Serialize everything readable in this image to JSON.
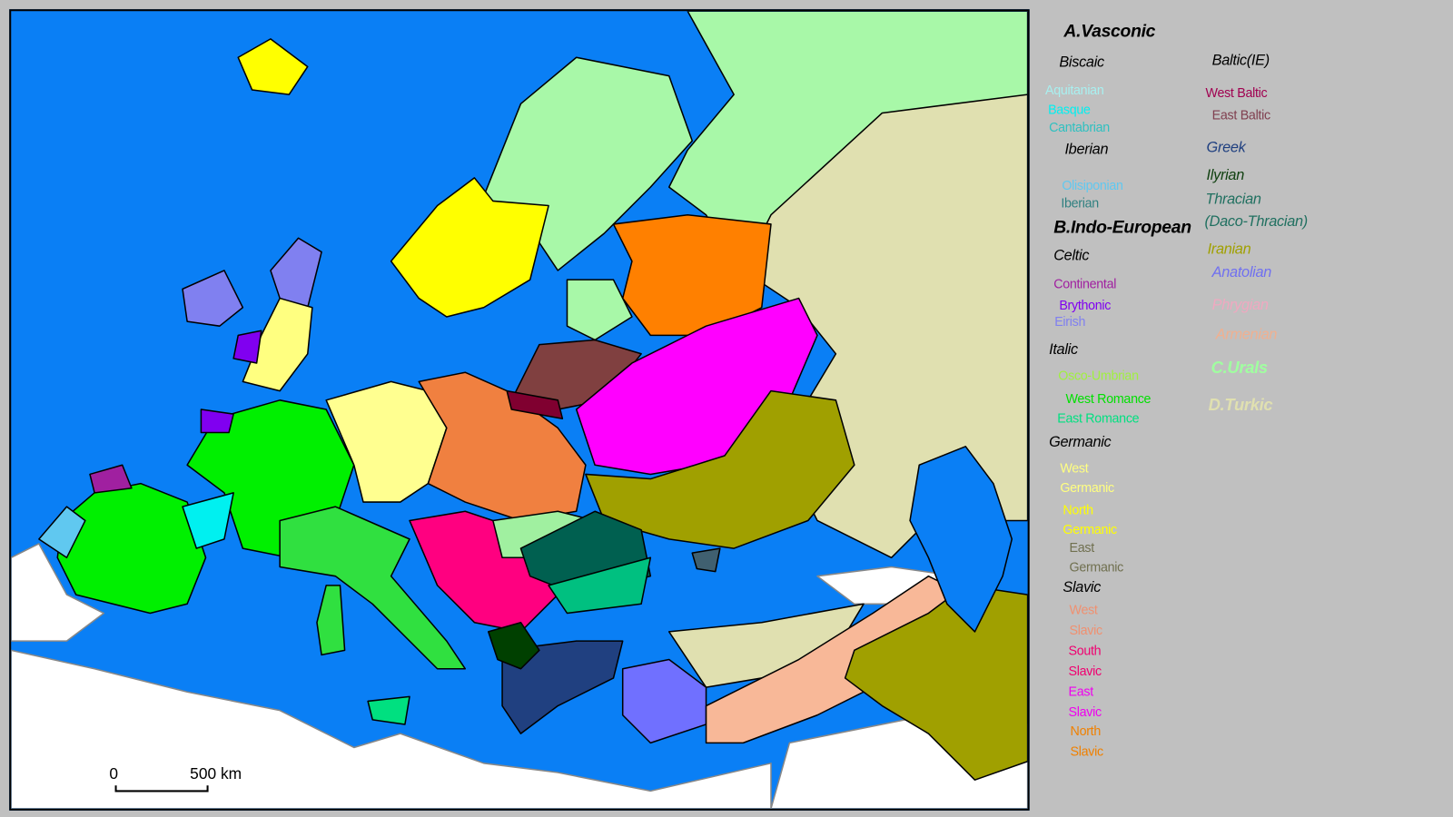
{
  "legend": {
    "a_vasconic": {
      "text": "A.Vasconic",
      "color": "#000000"
    },
    "biscaic": {
      "text": "Biscaic",
      "color": "#000000"
    },
    "aquitanian": {
      "text": "Aquitanian",
      "color": "#a8f0f0"
    },
    "basque": {
      "text": "Basque",
      "color": "#00f0f0"
    },
    "cantabrian": {
      "text": "Cantabrian",
      "color": "#30c0c0"
    },
    "iberian_group": {
      "text": "Iberian",
      "color": "#000000"
    },
    "olisiponian": {
      "text": "Olisiponian",
      "color": "#60c8f0"
    },
    "iberian": {
      "text": "Iberian",
      "color": "#308080"
    },
    "b_indo_european": {
      "text": "B.Indo-European",
      "color": "#000000"
    },
    "celtic": {
      "text": "Celtic",
      "color": "#000000"
    },
    "continental": {
      "text": "Continental",
      "color": "#a020a0"
    },
    "brythonic": {
      "text": "Brythonic",
      "color": "#8000f0"
    },
    "eirish": {
      "text": "Eirish",
      "color": "#8080f0"
    },
    "italic": {
      "text": "Italic",
      "color": "#000000"
    },
    "osco_umbrian": {
      "text": "Osco-Umbrian",
      "color": "#a0f040"
    },
    "west_romance": {
      "text": "West Romance",
      "color": "#00e000"
    },
    "east_romance": {
      "text": "East Romance",
      "color": "#00e080"
    },
    "germanic": {
      "text": "Germanic",
      "color": "#000000"
    },
    "west_germanic_1": {
      "text": "West",
      "color": "#ffff80"
    },
    "west_germanic_2": {
      "text": "Germanic",
      "color": "#ffff80"
    },
    "north_germanic_1": {
      "text": "North",
      "color": "#ffff00"
    },
    "north_germanic_2": {
      "text": "Germanic",
      "color": "#ffff00"
    },
    "east_germanic_1": {
      "text": "East",
      "color": "#707050"
    },
    "east_germanic_2": {
      "text": "Germanic",
      "color": "#707050"
    },
    "slavic": {
      "text": "Slavic",
      "color": "#000000"
    },
    "west_slavic_1": {
      "text": "West",
      "color": "#f09070"
    },
    "west_slavic_2": {
      "text": "Slavic",
      "color": "#f09070"
    },
    "south_slavic_1": {
      "text": "South",
      "color": "#f00070"
    },
    "south_slavic_2": {
      "text": "Slavic",
      "color": "#f00070"
    },
    "east_slavic_1": {
      "text": "East",
      "color": "#f000f0"
    },
    "east_slavic_2": {
      "text": "Slavic",
      "color": "#f000f0"
    },
    "north_slavic_1": {
      "text": "North",
      "color": "#f08000"
    },
    "north_slavic_2": {
      "text": "Slavic",
      "color": "#f08000"
    },
    "baltic": {
      "text": "Baltic(IE)",
      "color": "#000000"
    },
    "west_baltic": {
      "text": "West Baltic",
      "color": "#a00050"
    },
    "east_baltic": {
      "text": "East Baltic",
      "color": "#804050"
    },
    "greek": {
      "text": "Greek",
      "color": "#204080"
    },
    "ilyrian": {
      "text": "Ilyrian",
      "color": "#104010"
    },
    "thracian": {
      "text": "Thracian",
      "color": "#207060"
    },
    "daco_thracian": {
      "text": "(Daco-Thracian)",
      "color": "#207060"
    },
    "iranian": {
      "text": "Iranian",
      "color": "#a0a000"
    },
    "anatolian": {
      "text": "Anatolian",
      "color": "#7070f0"
    },
    "phrygian": {
      "text": "Phrygian",
      "color": "#f0a8c0"
    },
    "armenian": {
      "text": "Armenian",
      "color": "#f0b090"
    },
    "c_urals": {
      "text": "C.Urals",
      "color": "#a0ffa0"
    },
    "d_turkic": {
      "text": "D.Turkic",
      "color": "#e0e0b0"
    }
  },
  "scale_bar": {
    "start": "0",
    "end": "500 km"
  }
}
